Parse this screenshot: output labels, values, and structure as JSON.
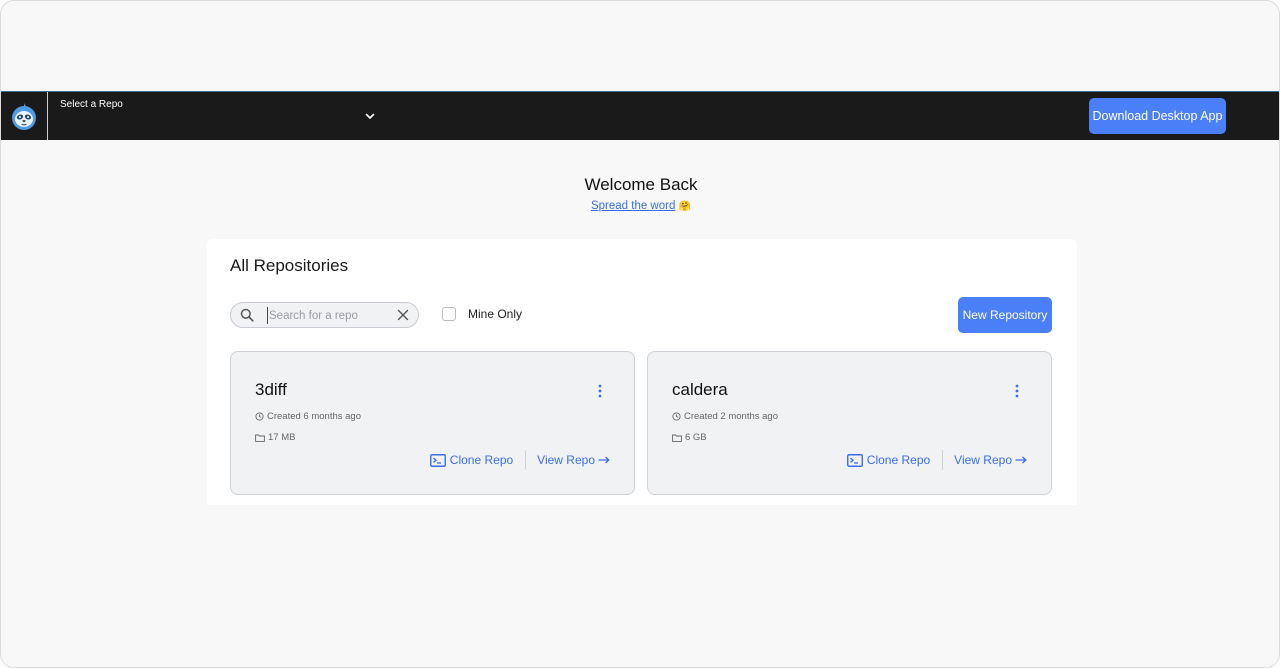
{
  "topbar": {
    "repo_select_label": "Select a Repo",
    "download_label": "Download Desktop App"
  },
  "welcome": {
    "title": "Welcome Back",
    "spread_link": "Spread the word",
    "spread_emoji": "🤗"
  },
  "panel": {
    "title": "All Repositories",
    "search_placeholder": "Search for a repo",
    "mine_only_label": "Mine Only",
    "new_repo_label": "New Repository"
  },
  "repos": [
    {
      "name": "3diff",
      "created": "Created 6 months ago",
      "size": "17 MB",
      "clone_label": "Clone Repo",
      "view_label": "View Repo"
    },
    {
      "name": "caldera",
      "created": "Created 2 months ago",
      "size": "6 GB",
      "clone_label": "Clone Repo",
      "view_label": "View Repo"
    }
  ],
  "colors": {
    "accent": "#4a7ff7",
    "link": "#3a6ee8",
    "topbar": "#1a1a1a"
  }
}
